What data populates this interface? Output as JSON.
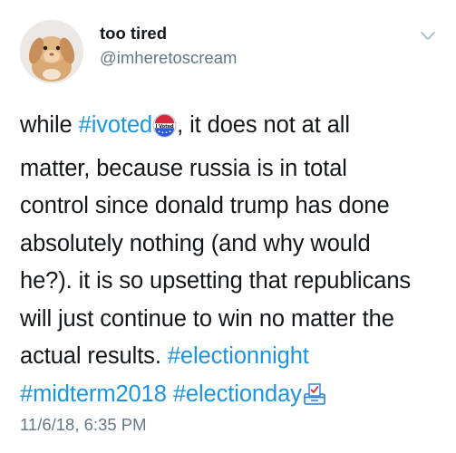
{
  "author": {
    "display_name": "too tired",
    "handle": "@imheretoscream"
  },
  "tweet": {
    "l1_a": "while ",
    "l1_tag": "#ivoted",
    "l1_b": ", it does not at all",
    "l2": "matter, because russia is in total",
    "l3": "control since donald trump has done",
    "l4": "absolutely nothing (and why would",
    "l5": "he?). it is so upsetting that republicans",
    "l6": "will just continue to win no matter the",
    "l7_a": "actual results. ",
    "l7_tag": "#electionnight",
    "l8_tag1": "#midterm2018",
    "l8_sp": " ",
    "l8_tag2": "#electionday",
    "voted_sticker_text": "I Voted"
  },
  "timestamp": "11/6/18, 6:35 PM",
  "icons": {
    "menu": "chevron-down-icon",
    "sticker": "i-voted-sticker-icon",
    "ballot": "ballot-box-icon"
  },
  "colors": {
    "hashtag": "#1b95e0",
    "secondary_text": "#657786",
    "primary_text": "#14171a"
  }
}
